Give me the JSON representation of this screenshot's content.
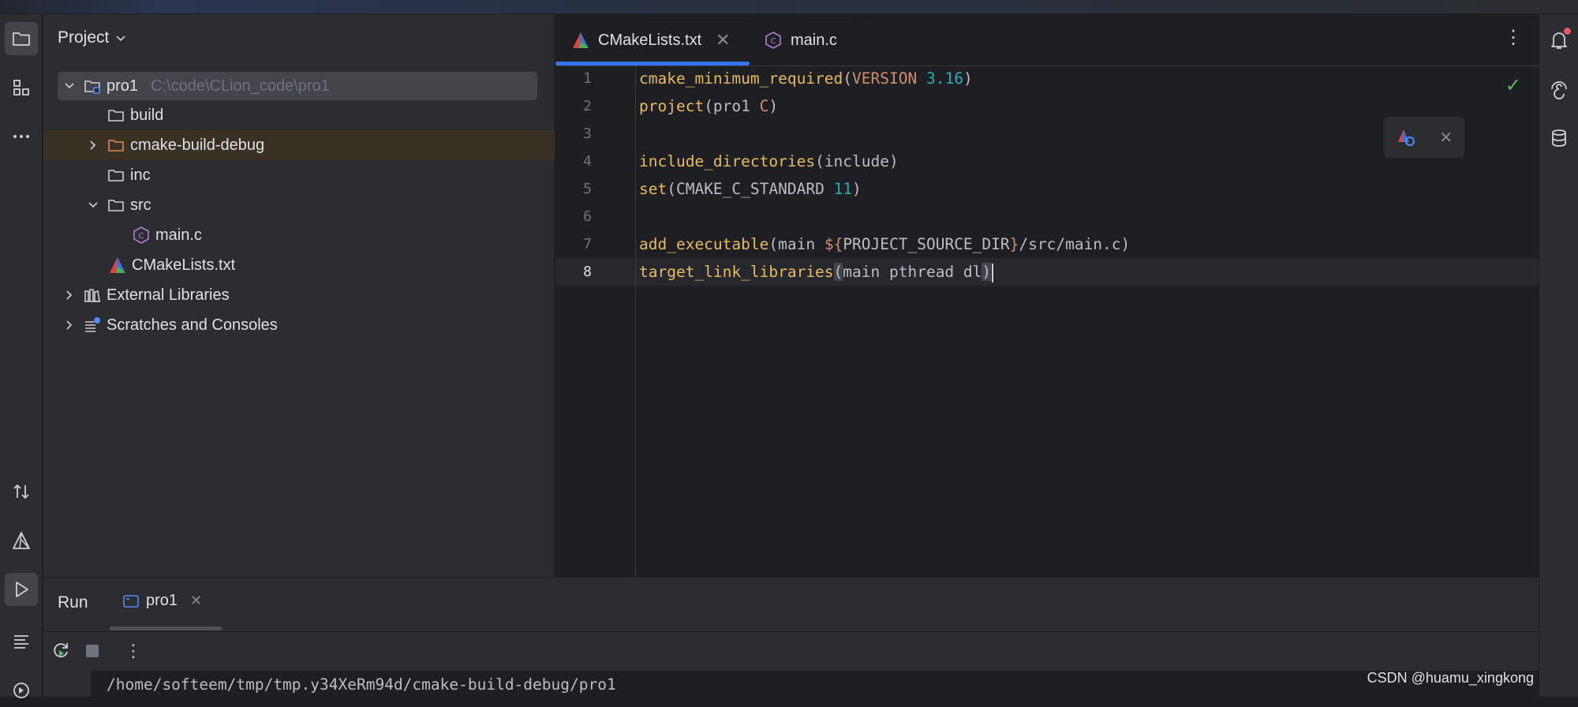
{
  "project_panel": {
    "title": "Project",
    "tree": [
      {
        "label": "pro1",
        "path": "C:\\code\\CLion_code\\pro1"
      },
      {
        "label": "build"
      },
      {
        "label": "cmake-build-debug"
      },
      {
        "label": "inc"
      },
      {
        "label": "src"
      },
      {
        "label": "main.c"
      },
      {
        "label": "CMakeLists.txt"
      },
      {
        "label": "External Libraries"
      },
      {
        "label": "Scratches and Consoles"
      }
    ]
  },
  "editor": {
    "tabs": [
      {
        "label": "CMakeLists.txt",
        "active": true
      },
      {
        "label": "main.c",
        "active": false
      }
    ],
    "line_numbers": [
      "1",
      "2",
      "3",
      "4",
      "5",
      "6",
      "7",
      "8"
    ],
    "current_line": "8",
    "code": {
      "l1_fn": "cmake_minimum_required",
      "l1_open": "(",
      "l1_kw": "VERSION",
      "l1_num": "3.16",
      "l1_close": ")",
      "l2_fn": "project",
      "l2_args": "(pro1 ",
      "l2_kw": "C",
      "l2_close": ")",
      "l4_fn": "include_directories",
      "l4_args": "(include)",
      "l5_fn": "set",
      "l5_args": "(CMAKE_C_STANDARD ",
      "l5_num": "11",
      "l5_close": ")",
      "l7_fn": "add_executable",
      "l7_args1": "(main ",
      "l7_var_open": "${",
      "l7_var": "PROJECT_SOURCE_DIR",
      "l7_var_close": "}",
      "l7_args2": "/src/main.c)",
      "l8_fn": "target_link_libraries",
      "l8_open": "(",
      "l8_args": "main pthread dl",
      "l8_close": ")"
    }
  },
  "run_panel": {
    "title": "Run",
    "tab_label": "pro1",
    "console_line": "/home/softeem/tmp/tmp.y34XeRm94d/cmake-build-debug/pro1"
  },
  "watermark": "CSDN @huamu_xingkong",
  "colors": {
    "accent": "#3574f0",
    "function": "#e8ba61",
    "keyword": "#cf8e6d",
    "number": "#2aacb8",
    "success": "#5fb865"
  }
}
